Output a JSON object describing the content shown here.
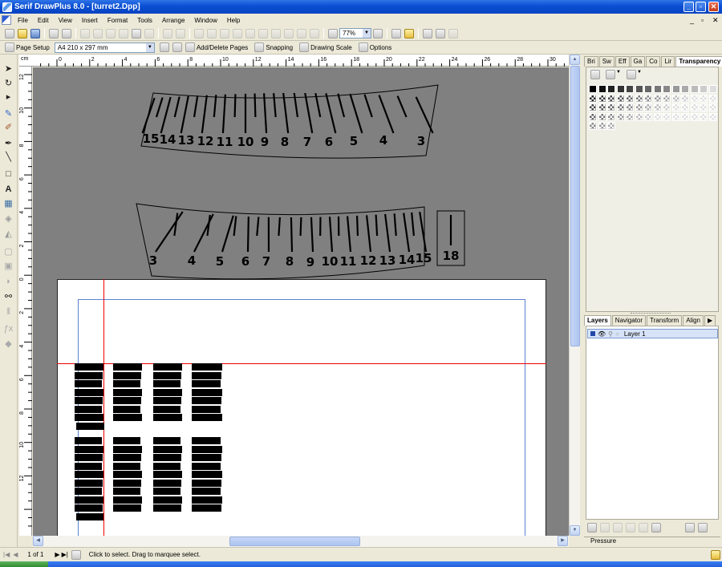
{
  "window": {
    "title": "Serif DrawPlus 8.0 - [turret2.Dpp]"
  },
  "menu": [
    "File",
    "Edit",
    "View",
    "Insert",
    "Format",
    "Tools",
    "Arrange",
    "Window",
    "Help"
  ],
  "toolbar": {
    "zoom": "77%"
  },
  "context_bar": {
    "page_setup_label": "Page Setup",
    "page_size": "A4 210 x 297 mm",
    "add_delete_label": "Add/Delete Pages",
    "snapping_label": "Snapping",
    "drawing_scale_label": "Drawing Scale",
    "options_label": "Options"
  },
  "ruler": {
    "unit": "cm",
    "h_ticks": [
      "0",
      "2",
      "4",
      "6",
      "8",
      "10",
      "12",
      "14",
      "16",
      "18",
      "20",
      "22",
      "24",
      "26",
      "28",
      "30"
    ],
    "v_ticks": [
      "12",
      "10",
      "8",
      "6",
      "4",
      "2",
      "0",
      "2",
      "4",
      "6",
      "8",
      "10",
      "12"
    ]
  },
  "dials": {
    "top": [
      "15",
      "14",
      "13",
      "12",
      "11",
      "10",
      "9",
      "8",
      "7",
      "6",
      "5",
      "4",
      "3"
    ],
    "bottom": [
      "3",
      "4",
      "5",
      "6",
      "7",
      "8",
      "9",
      "10",
      "11",
      "12",
      "13",
      "14",
      "15"
    ],
    "box": "18"
  },
  "panels": {
    "top_tabs": [
      "Bri",
      "Sw",
      "Eff",
      "Ga",
      "Co",
      "Lir",
      "Transparency"
    ],
    "bottom_tabs": [
      "Layers",
      "Navigator",
      "Transform",
      "Align"
    ],
    "layer_name": "Layer 1",
    "pressure_label": "Pressure"
  },
  "status": {
    "page": "1 of 1",
    "hint": "Click to select. Drag to marquee select."
  }
}
